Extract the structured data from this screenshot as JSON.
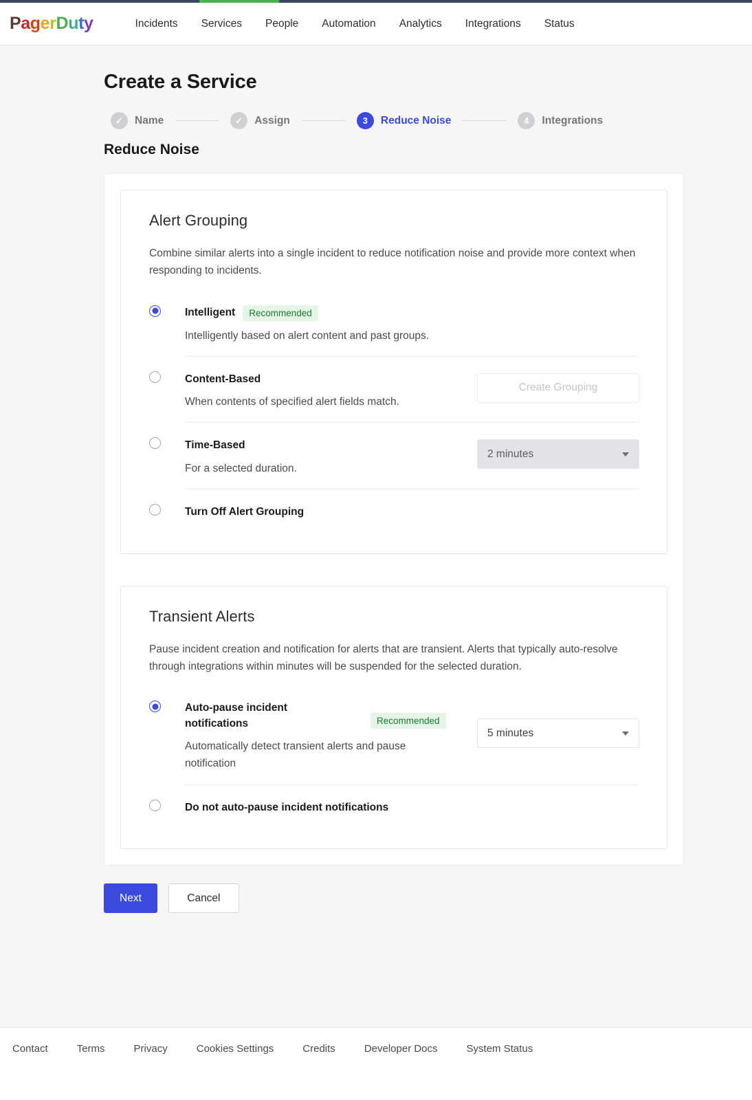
{
  "brand": {
    "logo_text": "PagerDuty",
    "logo_letters": [
      {
        "ch": "P",
        "color": "#5c3a2e"
      },
      {
        "ch": "a",
        "color": "#c62828"
      },
      {
        "ch": "g",
        "color": "#d84315"
      },
      {
        "ch": "e",
        "color": "#e8a020"
      },
      {
        "ch": "r",
        "color": "#b5c42a"
      },
      {
        "ch": "D",
        "color": "#4caf50"
      },
      {
        "ch": "u",
        "color": "#3fae8e"
      },
      {
        "ch": "t",
        "color": "#3f6fc4"
      },
      {
        "ch": "y",
        "color": "#7b3fb5"
      }
    ],
    "accent_blue": "#3b49df",
    "accent_green": "#4caf50",
    "topbar_navy": "#36495e"
  },
  "nav": {
    "items": [
      {
        "label": "Incidents",
        "active": false
      },
      {
        "label": "Services",
        "active": true
      },
      {
        "label": "People",
        "active": false
      },
      {
        "label": "Automation",
        "active": false
      },
      {
        "label": "Analytics",
        "active": false
      },
      {
        "label": "Integrations",
        "active": false
      },
      {
        "label": "Status",
        "active": false
      }
    ]
  },
  "page": {
    "title": "Create a Service",
    "section_title": "Reduce Noise"
  },
  "stepper": {
    "steps": [
      {
        "marker": "✓",
        "label": "Name",
        "state": "complete"
      },
      {
        "marker": "✓",
        "label": "Assign",
        "state": "complete"
      },
      {
        "marker": "3",
        "label": "Reduce Noise",
        "state": "active"
      },
      {
        "marker": "4",
        "label": "Integrations",
        "state": "upcoming"
      }
    ]
  },
  "alert_grouping": {
    "title": "Alert Grouping",
    "description": "Combine similar alerts into a single incident to reduce notification noise and provide more context when responding to incidents.",
    "options": [
      {
        "title": "Intelligent",
        "badge": "Recommended",
        "subtitle": "Intelligently based on alert content and past groups.",
        "selected": true,
        "control": null
      },
      {
        "title": "Content-Based",
        "badge": null,
        "subtitle": "When contents of specified alert fields match.",
        "selected": false,
        "control": {
          "kind": "button",
          "label": "Create Grouping",
          "disabled": true
        }
      },
      {
        "title": "Time-Based",
        "badge": null,
        "subtitle": "For a selected duration.",
        "selected": false,
        "control": {
          "kind": "select",
          "value": "2 minutes",
          "disabled": true
        }
      },
      {
        "title": "Turn Off Alert Grouping",
        "badge": null,
        "subtitle": null,
        "selected": false,
        "control": null
      }
    ]
  },
  "transient_alerts": {
    "title": "Transient Alerts",
    "description": "Pause incident creation and notification for alerts that are transient.  Alerts that typically auto-resolve through integrations within minutes will be suspended for the selected duration.",
    "options": [
      {
        "title": "Auto-pause incident notifications",
        "badge": "Recommended",
        "subtitle": "Automatically detect transient alerts and pause notification",
        "selected": true,
        "control": {
          "kind": "select",
          "value": "5 minutes",
          "disabled": false
        }
      },
      {
        "title": "Do not auto-pause incident notifications",
        "badge": null,
        "subtitle": null,
        "selected": false,
        "control": null
      }
    ]
  },
  "actions": {
    "next_label": "Next",
    "cancel_label": "Cancel"
  },
  "footer": {
    "links": [
      "Contact",
      "Terms",
      "Privacy",
      "Cookies Settings",
      "Credits",
      "Developer Docs",
      "System Status"
    ]
  }
}
